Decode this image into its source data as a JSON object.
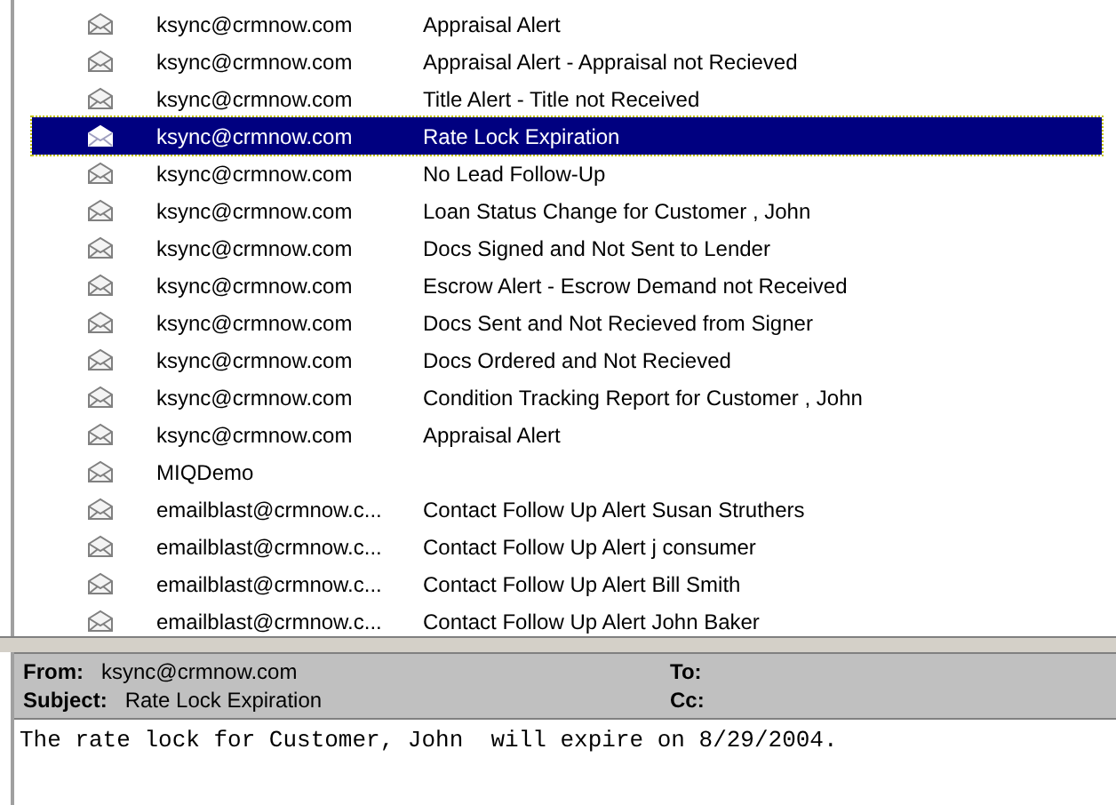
{
  "messages": [
    {
      "from": "ksync@crmnow.com",
      "subject": "Appraisal Alert",
      "selected": false
    },
    {
      "from": "ksync@crmnow.com",
      "subject": "Appraisal Alert - Appraisal not Recieved",
      "selected": false
    },
    {
      "from": "ksync@crmnow.com",
      "subject": "Title Alert - Title not Received",
      "selected": false
    },
    {
      "from": "ksync@crmnow.com",
      "subject": "Rate Lock Expiration",
      "selected": true
    },
    {
      "from": "ksync@crmnow.com",
      "subject": "No Lead Follow-Up",
      "selected": false
    },
    {
      "from": "ksync@crmnow.com",
      "subject": "Loan Status Change for Customer , John",
      "selected": false
    },
    {
      "from": "ksync@crmnow.com",
      "subject": "Docs Signed and Not Sent to Lender",
      "selected": false
    },
    {
      "from": "ksync@crmnow.com",
      "subject": "Escrow Alert - Escrow Demand not Received",
      "selected": false
    },
    {
      "from": "ksync@crmnow.com",
      "subject": "Docs Sent and Not Recieved from Signer",
      "selected": false
    },
    {
      "from": "ksync@crmnow.com",
      "subject": "Docs Ordered and Not Recieved",
      "selected": false
    },
    {
      "from": "ksync@crmnow.com",
      "subject": "Condition Tracking Report for Customer , John",
      "selected": false
    },
    {
      "from": "ksync@crmnow.com",
      "subject": "Appraisal Alert",
      "selected": false
    },
    {
      "from": "MIQDemo",
      "selected": false
    },
    {
      "from": "emailblast@crmnow.c...",
      "subject": "Contact Follow Up Alert Susan Struthers",
      "selected": false
    },
    {
      "from": "emailblast@crmnow.c...",
      "subject": "Contact Follow Up Alert j consumer",
      "selected": false
    },
    {
      "from": "emailblast@crmnow.c...",
      "subject": "Contact Follow Up Alert Bill Smith",
      "selected": false
    },
    {
      "from": "emailblast@crmnow.c...",
      "subject": "Contact Follow Up Alert John Baker",
      "selected": false
    }
  ],
  "preview": {
    "from_label": "From:",
    "from": "ksync@crmnow.com",
    "to_label": "To:",
    "subject_label": "Subject:",
    "subject": "Rate Lock Expiration",
    "cc_label": "Cc:",
    "body": "The rate lock for Customer, John  will expire on 8/29/2004."
  }
}
